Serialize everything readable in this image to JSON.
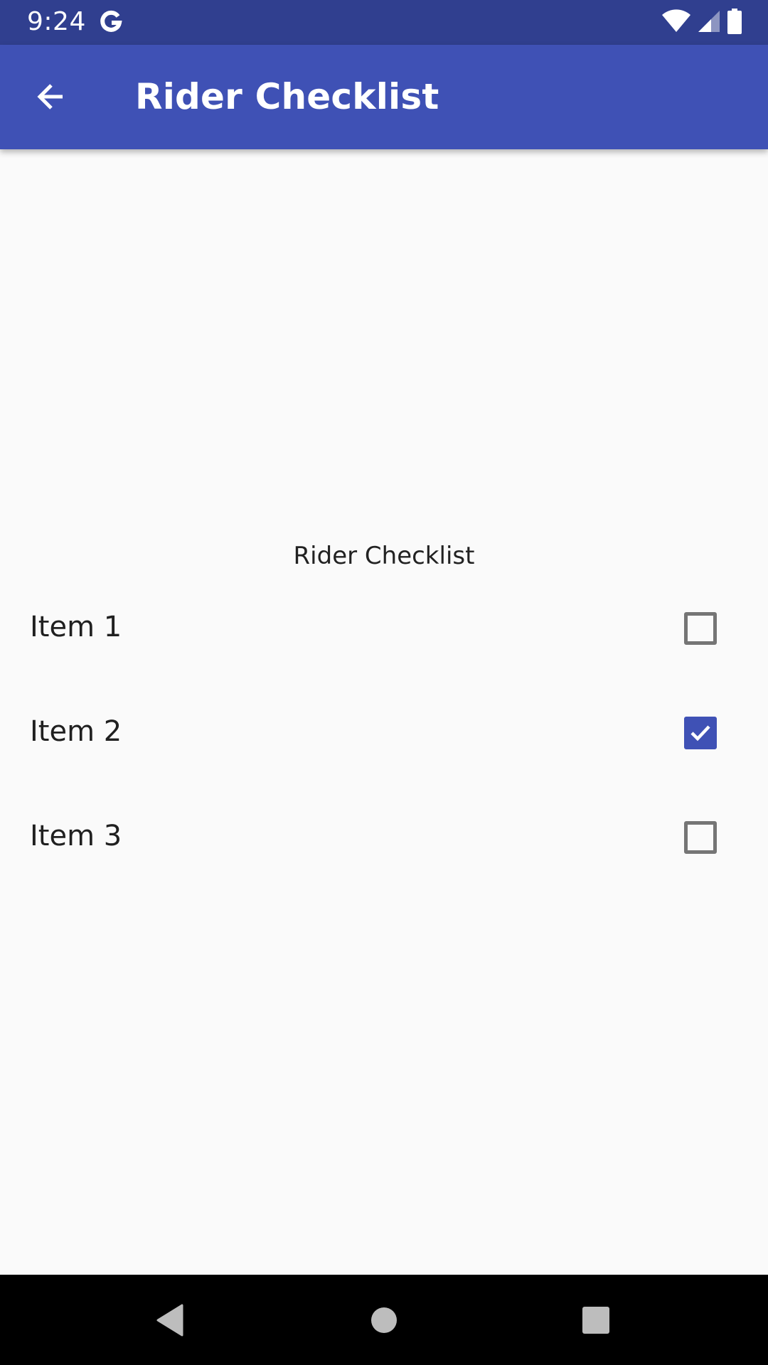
{
  "status_bar": {
    "time": "9:24",
    "icons": [
      "google-g-icon",
      "wifi-icon",
      "cellular-signal-icon",
      "battery-icon"
    ]
  },
  "app_bar": {
    "back_icon": "arrow-back-icon",
    "title": "Rider Checklist"
  },
  "main": {
    "heading": "Rider Checklist",
    "items": [
      {
        "label": "Item 1",
        "checked": false
      },
      {
        "label": "Item 2",
        "checked": true
      },
      {
        "label": "Item 3",
        "checked": false
      }
    ]
  },
  "nav_bar": {
    "icons": [
      "back-triangle-icon",
      "home-circle-icon",
      "recents-square-icon"
    ]
  },
  "colors": {
    "status_bar": "#303f8f",
    "app_bar": "#3f51b5",
    "accent": "#3f51b5",
    "background": "#fafafa",
    "checkbox_unchecked": "#757575"
  }
}
